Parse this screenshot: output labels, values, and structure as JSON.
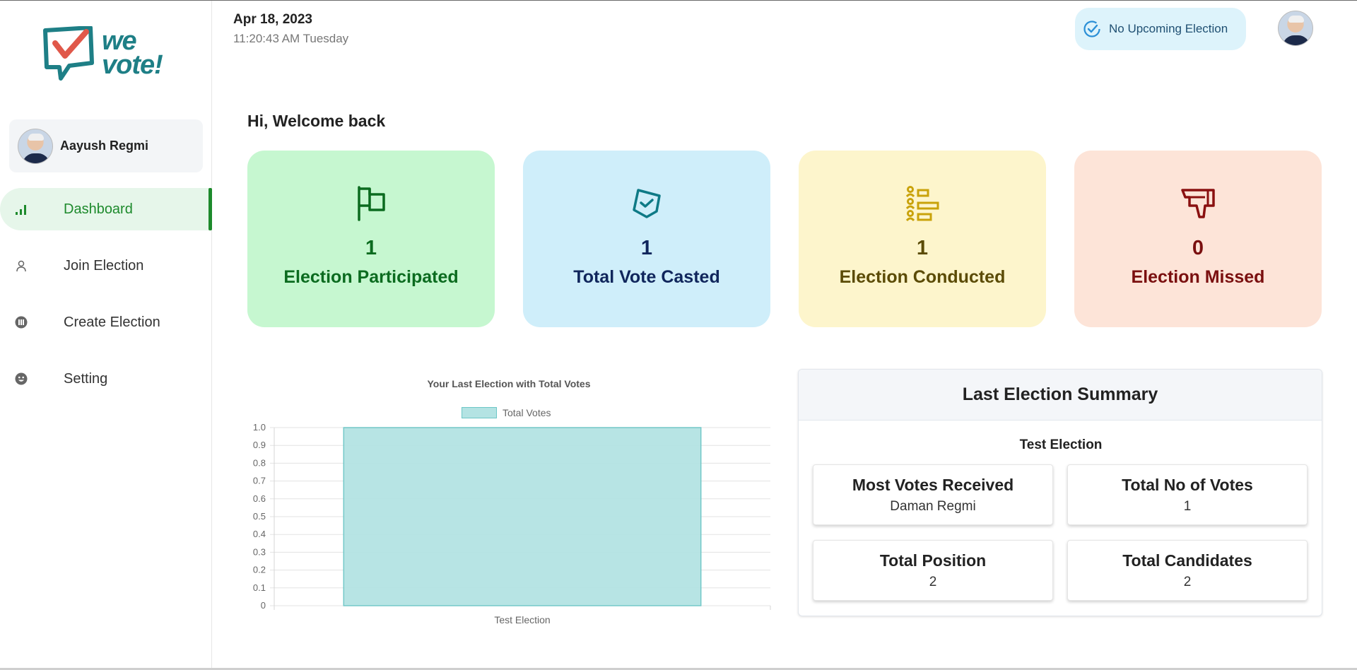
{
  "app": {
    "logo_text": "we vote!"
  },
  "header": {
    "date": "Apr 18, 2023",
    "time": "11:20:43 AM Tuesday",
    "upcoming_label": "No Upcoming Election"
  },
  "sidebar": {
    "user_name": "Aayush Regmi",
    "items": [
      {
        "label": "Dashboard",
        "icon": "bar-chart-icon",
        "active": true
      },
      {
        "label": "Join Election",
        "icon": "user-icon",
        "active": false
      },
      {
        "label": "Create Election",
        "icon": "ballot-icon",
        "active": false
      },
      {
        "label": "Setting",
        "icon": "face-icon",
        "active": false
      }
    ]
  },
  "main": {
    "welcome": "Hi, Welcome back",
    "stats": [
      {
        "value": "1",
        "label": "Election Participated",
        "icon": "flag-icon",
        "bg": "#c6f7d0",
        "color": "#0b6b1f"
      },
      {
        "value": "1",
        "label": "Total Vote Casted",
        "icon": "vote-icon",
        "bg": "#cfeefa",
        "color": "#10265c"
      },
      {
        "value": "1",
        "label": "Election Conducted",
        "icon": "candidates-list-icon",
        "bg": "#fdf5cc",
        "color": "#5b4b06"
      },
      {
        "value": "0",
        "label": "Election Missed",
        "icon": "thumbs-down-icon",
        "bg": "#fde4d8",
        "color": "#7a0f0f"
      }
    ]
  },
  "chart_data": {
    "type": "bar",
    "title": "Your Last Election with Total Votes",
    "categories": [
      "Test Election"
    ],
    "series": [
      {
        "name": "Total Votes",
        "values": [
          1
        ]
      }
    ],
    "ylim": [
      0,
      1
    ],
    "yticks": [
      "1.0",
      "0.9",
      "0.8",
      "0.7",
      "0.6",
      "0.5",
      "0.4",
      "0.3",
      "0.2",
      "0.1",
      "0"
    ],
    "grid": true,
    "legend": "top-center",
    "bar_color": "#b4e3e3",
    "bar_border": "#6cc6c6"
  },
  "summary": {
    "title": "Last Election Summary",
    "election_name": "Test Election",
    "cards": [
      {
        "label": "Most Votes Received",
        "value": "Daman Regmi"
      },
      {
        "label": "Total No of Votes",
        "value": "1"
      },
      {
        "label": "Total Position",
        "value": "2"
      },
      {
        "label": "Total Candidates",
        "value": "2"
      }
    ]
  }
}
